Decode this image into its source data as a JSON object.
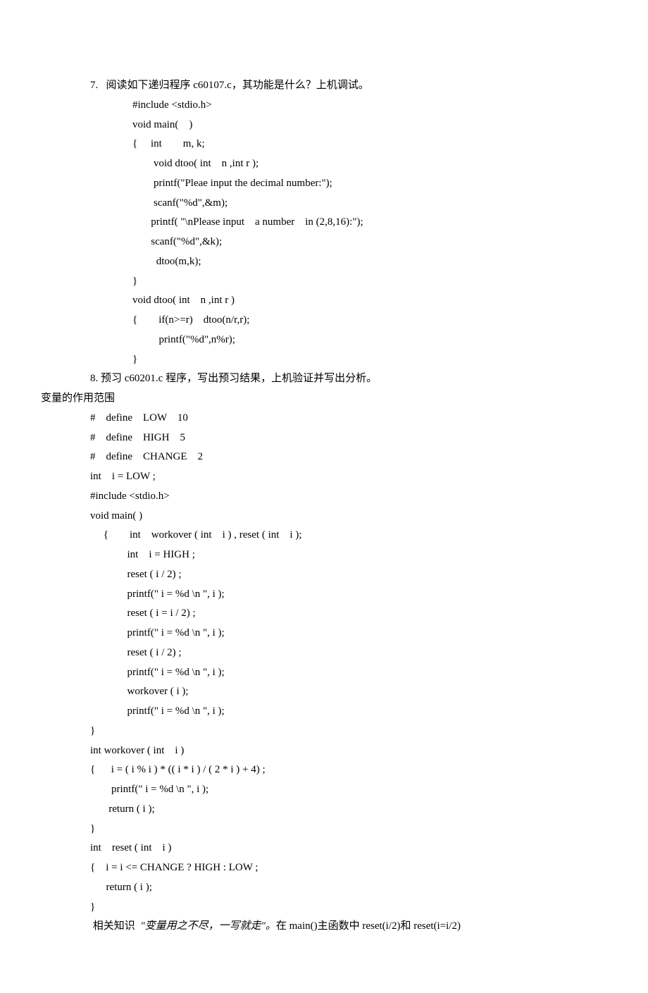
{
  "lines": [
    "7.   阅读如下递归程序 c60107.c，其功能是什么？上机调试。",
    "                #include <stdio.h>",
    "                void main(    )",
    "                {     int        m, k;",
    "                        void dtoo( int    n ,int r );",
    "                        printf(\"Pleae input the decimal number:\");",
    "                        scanf(\"%d\",&m);",
    "                       printf( \"\\nPlease input    a number    in (2,8,16):\");",
    "                       scanf(\"%d\",&k);",
    "                         dtoo(m,k);",
    "                }",
    "                void dtoo( int    n ,int r )",
    "                {        if(n>=r)    dtoo(n/r,r);",
    "                          printf(\"%d\",n%r);",
    "                }"
  ],
  "line8": "8. 预习 c60201.c 程序，写出预习结果，上机验证并写出分析。",
  "lineScope": "变量的作用范围",
  "code2": [
    "#    define    LOW    10",
    "#    define    HIGH    5",
    "#    define    CHANGE    2",
    "int    i = LOW ;",
    "#include <stdio.h>",
    "void main( )",
    "     {        int    workover ( int    i ) , reset ( int    i );",
    "              int    i = HIGH ;",
    "              reset ( i / 2) ;",
    "              printf(\" i = %d \\n \", i );",
    "              reset ( i = i / 2) ;",
    "              printf(\" i = %d \\n \", i );",
    "              reset ( i / 2) ;",
    "              printf(\" i = %d \\n \", i );",
    "              workover ( i );",
    "              printf(\" i = %d \\n \", i );",
    "}",
    "int workover ( int    i )",
    "{      i = ( i % i ) * (( i * i ) / ( 2 * i ) + 4) ;",
    "        printf(\" i = %d \\n \", i );",
    "       return ( i );",
    "}",
    "int    reset ( int    i )",
    "{    i = i <= CHANGE ? HIGH : LOW ;",
    "      return ( i );",
    "}"
  ],
  "footerPrefix": " 相关知识  ",
  "footerItalic": "\"变量用之不尽，一写就走\"。",
  "footerSuffix": "在 main()主函数中 reset(i/2)和 reset(i=i/2)"
}
